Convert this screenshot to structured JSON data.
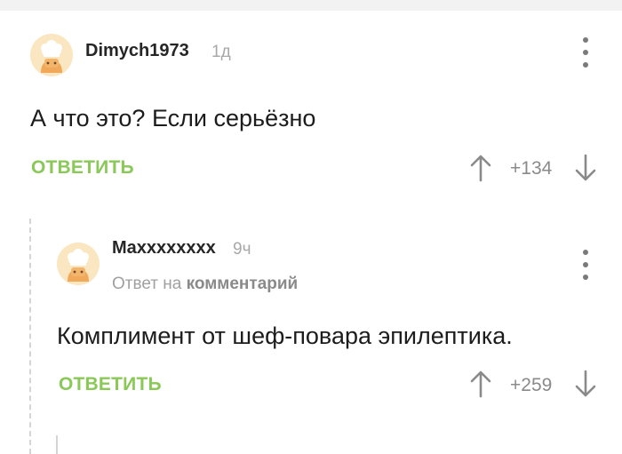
{
  "comments": [
    {
      "username": "Dimych1973",
      "time": "1д",
      "text": "А что это? Если серьёзно",
      "reply_label": "ОТВЕТИТЬ",
      "rating": "+134"
    },
    {
      "username": "Maxxxxxxxx",
      "time": "9ч",
      "reply_to_prefix": "Ответ на",
      "reply_to_target": "комментарий",
      "text": "Комплимент от шеф-повара эпилептика.",
      "reply_label": "ОТВЕТИТЬ",
      "rating": "+259"
    }
  ],
  "icons": {
    "avatar": "chef-avatar-icon",
    "more": "more-vertical-icon",
    "vote_up": "arrow-up-icon",
    "vote_down": "arrow-down-icon"
  },
  "colors": {
    "accent": "#8ac858",
    "text": "#1c1c1c",
    "muted": "#a8a8a8",
    "avatar_bg": "#fbe6c2"
  }
}
